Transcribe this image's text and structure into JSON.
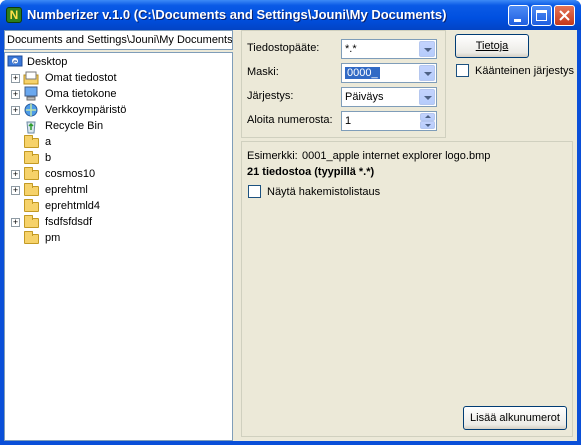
{
  "window": {
    "title": "Numberizer v.1.0 (C:\\Documents and Settings\\Jouni\\My Documents)",
    "app_icon_glyph": "N"
  },
  "left": {
    "path": "Documents and Settings\\Jouni\\My Documents",
    "tree": [
      {
        "label": "Desktop",
        "icon": "desktop-icon",
        "expander": ""
      },
      {
        "label": "Omat tiedostot",
        "icon": "my-documents-icon",
        "expander": "+"
      },
      {
        "label": "Oma tietokone",
        "icon": "my-computer-icon",
        "expander": "+"
      },
      {
        "label": "Verkkoympäristö",
        "icon": "network-places-icon",
        "expander": "+"
      },
      {
        "label": "Recycle Bin",
        "icon": "recycle-bin-icon",
        "expander": ""
      },
      {
        "label": "a",
        "icon": "folder-icon",
        "expander": ""
      },
      {
        "label": "b",
        "icon": "folder-icon",
        "expander": ""
      },
      {
        "label": "cosmos10",
        "icon": "folder-icon",
        "expander": "+"
      },
      {
        "label": "eprehtml",
        "icon": "folder-icon",
        "expander": "+"
      },
      {
        "label": "eprehtmld4",
        "icon": "folder-icon",
        "expander": ""
      },
      {
        "label": "fsdfsfdsdf",
        "icon": "folder-icon",
        "expander": "+"
      },
      {
        "label": "pm",
        "icon": "folder-icon",
        "expander": ""
      }
    ]
  },
  "settings": {
    "filetype_label": "Tiedostopääte:",
    "filetype_value": "*.*",
    "mask_label": "Maski:",
    "mask_value": "0000_",
    "order_label": "Järjestys:",
    "order_value": "Päiväys",
    "start_label": "Aloita numerosta:",
    "start_value": "1"
  },
  "actions": {
    "info_button": "Tietoja",
    "reverse_label": "Käänteinen järjestys",
    "add_button": "Lisää alkunumerot"
  },
  "info": {
    "example_prefix": "Esimerkki:",
    "example_value": "0001_apple internet explorer logo.bmp",
    "file_count": "21 tiedostoa (tyypillä *.*)",
    "show_dir_label": "Näytä hakemistolistaus"
  }
}
